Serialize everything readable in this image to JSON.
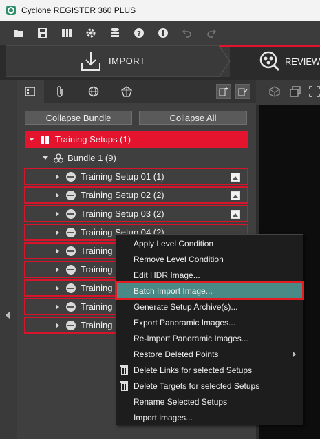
{
  "window": {
    "title": "Cyclone REGISTER 360 PLUS"
  },
  "toolbar": {
    "icons": [
      "open-folder-icon",
      "save-icon",
      "archive-icon",
      "settings-icon",
      "database-icon",
      "help-icon",
      "info-icon",
      "undo-icon",
      "redo-icon"
    ]
  },
  "workflow_tabs": {
    "import_label": "IMPORT",
    "review_label": "REVIEW"
  },
  "panel": {
    "collapse_bundle": "Collapse Bundle",
    "collapse_all": "Collapse All"
  },
  "tree": {
    "root_label": "Training Setups (1)",
    "bundle_label": "Bundle 1 (9)",
    "setups": [
      {
        "label": "Training Setup 01 (1)"
      },
      {
        "label": "Training Setup 02 (2)"
      },
      {
        "label": "Training Setup 03 (2)"
      },
      {
        "label": "Training Setup 04 (2)"
      },
      {
        "label": "Training"
      },
      {
        "label": "Training"
      },
      {
        "label": "Training"
      },
      {
        "label": "Training"
      },
      {
        "label": "Training"
      }
    ]
  },
  "context_menu": {
    "items": [
      {
        "label": "Apply Level Condition"
      },
      {
        "label": "Remove Level Condition"
      },
      {
        "label": "Edit HDR Image..."
      },
      {
        "label": "Batch Import Image..."
      },
      {
        "label": "Generate Setup Archive(s)..."
      },
      {
        "label": "Export Panoramic Images..."
      },
      {
        "label": "Re-Import Panoramic Images..."
      },
      {
        "label": "Restore Deleted Points"
      },
      {
        "label": "Delete Links for selected Setups"
      },
      {
        "label": "Delete Targets for selected Setups"
      },
      {
        "label": "Rename Selected Setups"
      },
      {
        "label": "Import images..."
      }
    ],
    "highlighted": "Batch Import Image..."
  },
  "colors": {
    "accent": "#e3122d",
    "highlight": "#4a8a86"
  }
}
